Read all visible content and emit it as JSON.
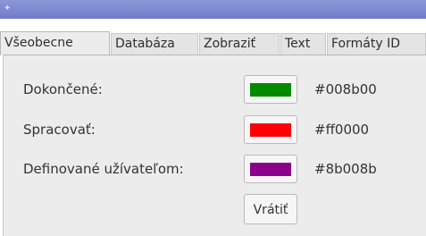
{
  "window": {
    "title_icon": "app-icon"
  },
  "tabs": [
    {
      "label": "Všeobecne",
      "active": true
    },
    {
      "label": "Databáza",
      "active": false
    },
    {
      "label": "Zobraziť",
      "active": false
    },
    {
      "label": "Text",
      "active": false
    },
    {
      "label": "Formáty ID",
      "active": false
    }
  ],
  "colors": [
    {
      "label": "Dokončené:",
      "hex": "#008b00",
      "swatch_color": "#008b00"
    },
    {
      "label": "Spracovať:",
      "hex": "#ff0000",
      "swatch_color": "#ff0000"
    },
    {
      "label": "Definované užívateľom:",
      "hex": "#8b008b",
      "swatch_color": "#8b008b"
    }
  ],
  "revert_button": {
    "label": "Vrátiť"
  }
}
